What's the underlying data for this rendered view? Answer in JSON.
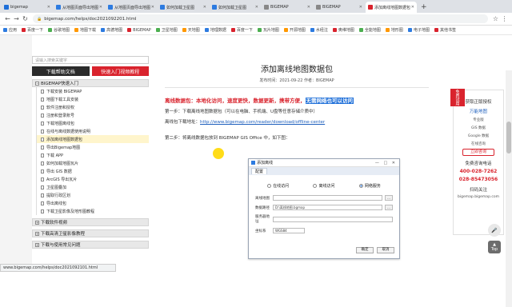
{
  "browser": {
    "tabs": [
      {
        "label": "bigemap",
        "color": "#1e6fd9"
      },
      {
        "label": "从地图页面导出地图",
        "color": "#2d7be0"
      },
      {
        "label": "从地图页面导出地图",
        "color": "#2d7be0"
      },
      {
        "label": "如何加载卫星图",
        "color": "#2d7be0"
      },
      {
        "label": "如何加载卫星图",
        "color": "#2d7be0"
      },
      {
        "label": "BIGEMAP",
        "color": "#888888"
      },
      {
        "label": "BIGEMAP",
        "color": "#888888"
      },
      {
        "label": "添加离线地图数据包",
        "color": "#d9232d",
        "active": true
      }
    ],
    "new_tab": "+",
    "url": "bigemap.com/helps/doc2021092201.html",
    "bookmarks": [
      "应用",
      "百度一下",
      "谷歌地图",
      "地图下载",
      "高德地图",
      "BIGEMAP",
      "卫星地图",
      "天地图",
      "地理数据",
      "百度一下",
      "瓦片地图",
      "开源地图",
      "水经注",
      "奥维地图",
      "全能地图",
      "地形图",
      "电子地图",
      "其他书签"
    ]
  },
  "sidebar": {
    "search_placeholder": "请输入搜索关键字",
    "btn_download": "下载帮助文档",
    "btn_quickstart": "快速入门视频教程",
    "category_open": "BIGEMAP快速入门",
    "items": [
      "下载安装 BIGEMAP",
      "地图下载工具安装",
      "软件注册和授权",
      "注册和登录账号",
      "下载地图离线包",
      "在线与离线数据使用说明",
      "添加离线地图数据包",
      "导出Bigemap地图",
      "下载 APP",
      "如何加载地图瓦片",
      "导出 GIS 数据",
      "ArcGIS 导出瓦片",
      "卫星图叠加",
      "提取行政区划",
      "导出离线包",
      "下载卫星影像及地形图教程"
    ],
    "category_more_1": "下载软件视频",
    "category_more_2": "下载高清卫星影像教程",
    "category_more_3": "下载与使用常见问题"
  },
  "article": {
    "title": "添加离线地图数据包",
    "meta": "发布时间：2021-09-22  作者：BIGEMAP",
    "red_note": "离线数据包：本地化访问，速度更快，数据更新，携带方便，",
    "red_note_hl": "无需网络也可以访问",
    "step1": "第一步：下载离线地图数据包（可以在电脑、手机端、U盘等任意存储介质中）",
    "step1b_prefix": "离线包下载地址：",
    "step1b_link": "http://www.bigemap.com/reader/download/offline-center",
    "step2": "第二步：将离线数据包放到 BIGEMAP GIS Office 中，如下图："
  },
  "dialog": {
    "title": "添加离线",
    "window_controls": "— □ ✕",
    "tabs": [
      "配置"
    ],
    "radios": [
      "在线访问",
      "离线访问",
      "网络服务"
    ],
    "fields": [
      {
        "label": "离线地图",
        "value": "",
        "button": "..."
      },
      {
        "label": "数据路径",
        "value": "D:\\离线地图.bgmap",
        "button": "..."
      },
      {
        "label": "服务器地址",
        "value": "",
        "button": ""
      },
      {
        "label": "坐标系",
        "value": "WGS84",
        "button": ""
      }
    ],
    "ok": "确定",
    "cancel": "取消"
  },
  "ad": {
    "ribbon": "免费试用",
    "lines": [
      "获取正版授权",
      "万能地图",
      "专业版",
      "GIS 数据",
      "Google 数据",
      "在线咨询"
    ],
    "btn": "立即咨询",
    "hotline_label": "免费咨询电话",
    "phone1": "400-028-7262",
    "phone2": "028-85473056",
    "qr_label": "扫码关注",
    "site": "bigemap.bigemap.com"
  },
  "right_side": {
    "top_label": "Top"
  },
  "status_url": "www.bigemap.com/helps/doc2021092101.html"
}
